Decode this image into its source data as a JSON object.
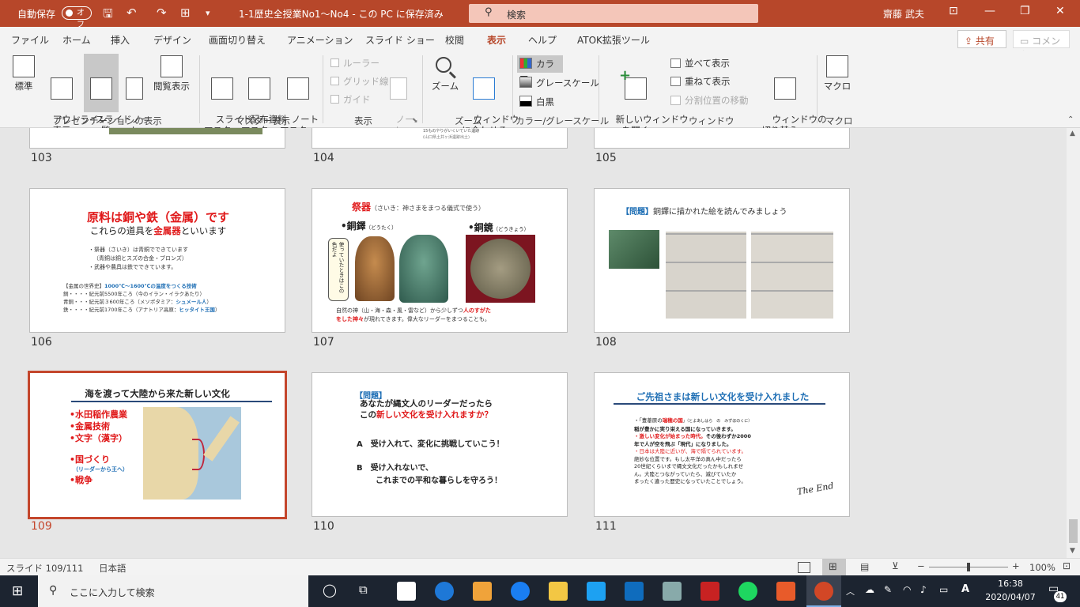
{
  "titlebar": {
    "autosave": "自動保存",
    "autosave_state": "オフ",
    "doc_title": "1-1歴史全授業No1～No4 - この PC に保存済み",
    "search_placeholder": "検索",
    "user": "齋藤 武夫"
  },
  "tabs": [
    "ファイル",
    "ホーム",
    "挿入",
    "デザイン",
    "画面切り替え",
    "アニメーション",
    "スライド ショー",
    "校閲",
    "表示",
    "ヘルプ",
    "ATOK拡張ツール"
  ],
  "active_tab": "表示",
  "share": "共有",
  "comment": "コメント",
  "ribbon": {
    "views": [
      "標準",
      "アウトライン\n表示",
      "スライド\n一覧",
      "ノー\nト",
      "閲覧表示"
    ],
    "group_views": "プレゼンテーションの表示",
    "masters": [
      "スライド\nマスター",
      "配布資料\nマスター",
      "ノート\nマスター"
    ],
    "group_masters": "マスター表示",
    "show_items": [
      "ルーラー",
      "グリッド線",
      "ガイド"
    ],
    "notes": "ノー\nト",
    "group_show": "表示",
    "zoom": "ズーム",
    "fit": "ウィンドウ\nに合わせる",
    "group_zoom": "ズーム",
    "color_items": [
      "カラー",
      "グレースケール",
      "白黒"
    ],
    "group_color": "カラー/グレースケール",
    "new_window": "新しいウィンドウ\nを開く",
    "arrange": "並べて表示",
    "cascade": "重ねて表示",
    "move_split": "分割位置の移動",
    "switch_windows": "ウィンドウの\n切り替え ⌄",
    "group_window": "ウィンドウ",
    "macro": "マクロ",
    "group_macro": "マクロ"
  },
  "slides": {
    "n103": "103",
    "n104": "104",
    "n105": "105",
    "n106": "106",
    "n107": "107",
    "n108": "108",
    "n109": "109",
    "n110": "110",
    "n111": "111",
    "s104_caption": "15ものやりがいくいていた遺跡",
    "s104_caption2": "(山口県土井ヶ浜遺跡出土)",
    "s106": {
      "title": "原料は銅や鉄（金属）です",
      "sub_pre": "これらの道具を",
      "sub_em": "金属器",
      "sub_post": "といいます",
      "b1": "・祭器（さいき）は青銅でできています",
      "b2": "（青銅は銅とスズの合金・ブロンズ）",
      "b3": "・武器や農具は鉄でできています。",
      "h_pre": "【金属の世界史】",
      "h_em": "1000℃～1600℃の温度をつくる技術",
      "l1_pre": "銅・・・・紀元前5500年ころ（今のイラン・イラクあたり）",
      "l2_pre": "青銅・・・紀元前３600年ころ（メソポタミア：",
      "l2_em": "シュメール人",
      "l2_post": "）",
      "l3_pre": "鉄・・・・紀元前1700年ころ（アナトリア高原：",
      "l3_em": "ヒッタイト王国",
      "l3_post": "）"
    },
    "s107": {
      "title": "祭器",
      "title_note": "（さいき：神さまをまつる儀式で使う）",
      "dotaku": "•銅鐸",
      "dotaku_r": "（どうたく）",
      "dokyo": "•銅鏡",
      "dokyo_r": "（どうきょう）",
      "bubble": "使っていたときはこの色だよ",
      "foot1_pre": "自然の神（山・海・森・風・雷など）から少しずつ",
      "foot1_em": "人のすがた",
      "foot2_em": "をした神々",
      "foot2_post": "が現れてきます。偉大なリーダーをまつることも。"
    },
    "s108": {
      "label": "【問題】",
      "text": "銅鐸に描かれた絵を読んでみましょう"
    },
    "s109": {
      "title": "海を渡って大陸から来た新しい文化",
      "items": [
        "•水田稲作農業",
        "•金属技術",
        "•文字（漢字）"
      ],
      "item4": "•国づくり",
      "item4_note": "（リーダーから王へ）",
      "item5": "•戦争"
    },
    "s110": {
      "label": "【問題】",
      "q1": "あなたが縄文人のリーダーだったら",
      "q2_pre": "この",
      "q2_em": "新しい文化を受け入れますか？",
      "a": "A　受け入れて、変化に挑戦していこう！",
      "b1": "B　受け入れないで、",
      "b2": "これまでの平和な暮らしを守ろう！"
    },
    "s111": {
      "title": "ご先祖さまは新しい文化を受け入れました",
      "p1_pre": "・「豊葦原の",
      "p1_em": "瑞穂の国",
      "p1_post": "」（とよあしはら　の　みずほのくに）",
      "p1b": "稲が豊かに実り栄える国になっていきます。",
      "p2_em": "・激しい変化が始まった時代。",
      "p2_post": "その後わずか2000",
      "p2b": "年で人が空を飛ぶ「現代」になりました。",
      "p3_em": "・日本は大陸に近いが、海で隔てられています。",
      "p3b": "絶妙な位置です。もし太平洋の真ん中だったら",
      "p3c": "20世紀くらいまで縄文文化だったかもしれませ",
      "p3d": "ん。大陸とつながっていたら、滅びていたか",
      "p3e": "まったく違った歴史になっていたことでしょう。",
      "sign": "The End"
    }
  },
  "status": {
    "slide": "スライド 109/111",
    "lang": "日本語",
    "zoom": "100%"
  },
  "taskbar": {
    "search": "ここに入力して検索",
    "time": "16:38",
    "date": "2020/04/07",
    "badge": "41"
  },
  "colors": {
    "accent": "#b7472a",
    "selection": "#c4462c"
  }
}
